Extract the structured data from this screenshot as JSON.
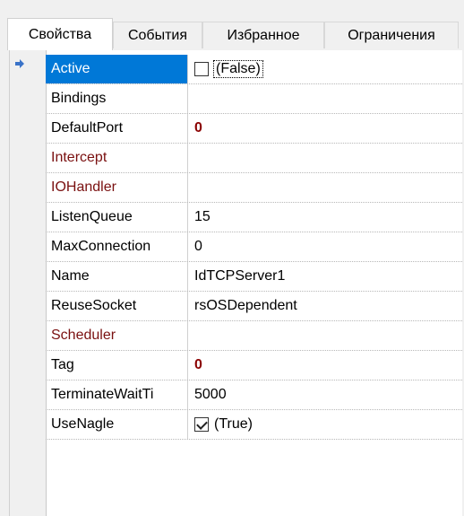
{
  "tabs": [
    {
      "label": "Свойства",
      "active": true
    },
    {
      "label": "События",
      "active": false
    },
    {
      "label": "Избранное",
      "active": false
    },
    {
      "label": "Ограничения",
      "active": false
    }
  ],
  "properties": [
    {
      "name": "Active",
      "value": "(False)",
      "kind": "checkbox",
      "checked": false,
      "selected": true,
      "ref": false
    },
    {
      "name": "Bindings",
      "value": "",
      "kind": "text",
      "selected": false,
      "ref": false
    },
    {
      "name": "DefaultPort",
      "value": "0",
      "kind": "bold",
      "selected": false,
      "ref": false
    },
    {
      "name": "Intercept",
      "value": "",
      "kind": "text",
      "selected": false,
      "ref": true
    },
    {
      "name": "IOHandler",
      "value": "",
      "kind": "text",
      "selected": false,
      "ref": true
    },
    {
      "name": "ListenQueue",
      "value": "15",
      "kind": "text",
      "selected": false,
      "ref": false
    },
    {
      "name": "MaxConnection",
      "value": "0",
      "kind": "text",
      "selected": false,
      "ref": false
    },
    {
      "name": "Name",
      "value": "IdTCPServer1",
      "kind": "text",
      "selected": false,
      "ref": false
    },
    {
      "name": "ReuseSocket",
      "value": "rsOSDependent",
      "kind": "text",
      "selected": false,
      "ref": false
    },
    {
      "name": "Scheduler",
      "value": "",
      "kind": "text",
      "selected": false,
      "ref": true
    },
    {
      "name": "Tag",
      "value": "0",
      "kind": "bold",
      "selected": false,
      "ref": false
    },
    {
      "name": "TerminateWaitTi",
      "value": "5000",
      "kind": "text",
      "selected": false,
      "ref": false
    },
    {
      "name": "UseNagle",
      "value": "(True)",
      "kind": "checkbox",
      "checked": true,
      "selected": false,
      "ref": false
    }
  ],
  "icons": {
    "current_row": "arrow-right-icon"
  },
  "colors": {
    "selection": "#0078d7",
    "reference_name": "#7a1010",
    "bold_value": "#8b0000"
  }
}
